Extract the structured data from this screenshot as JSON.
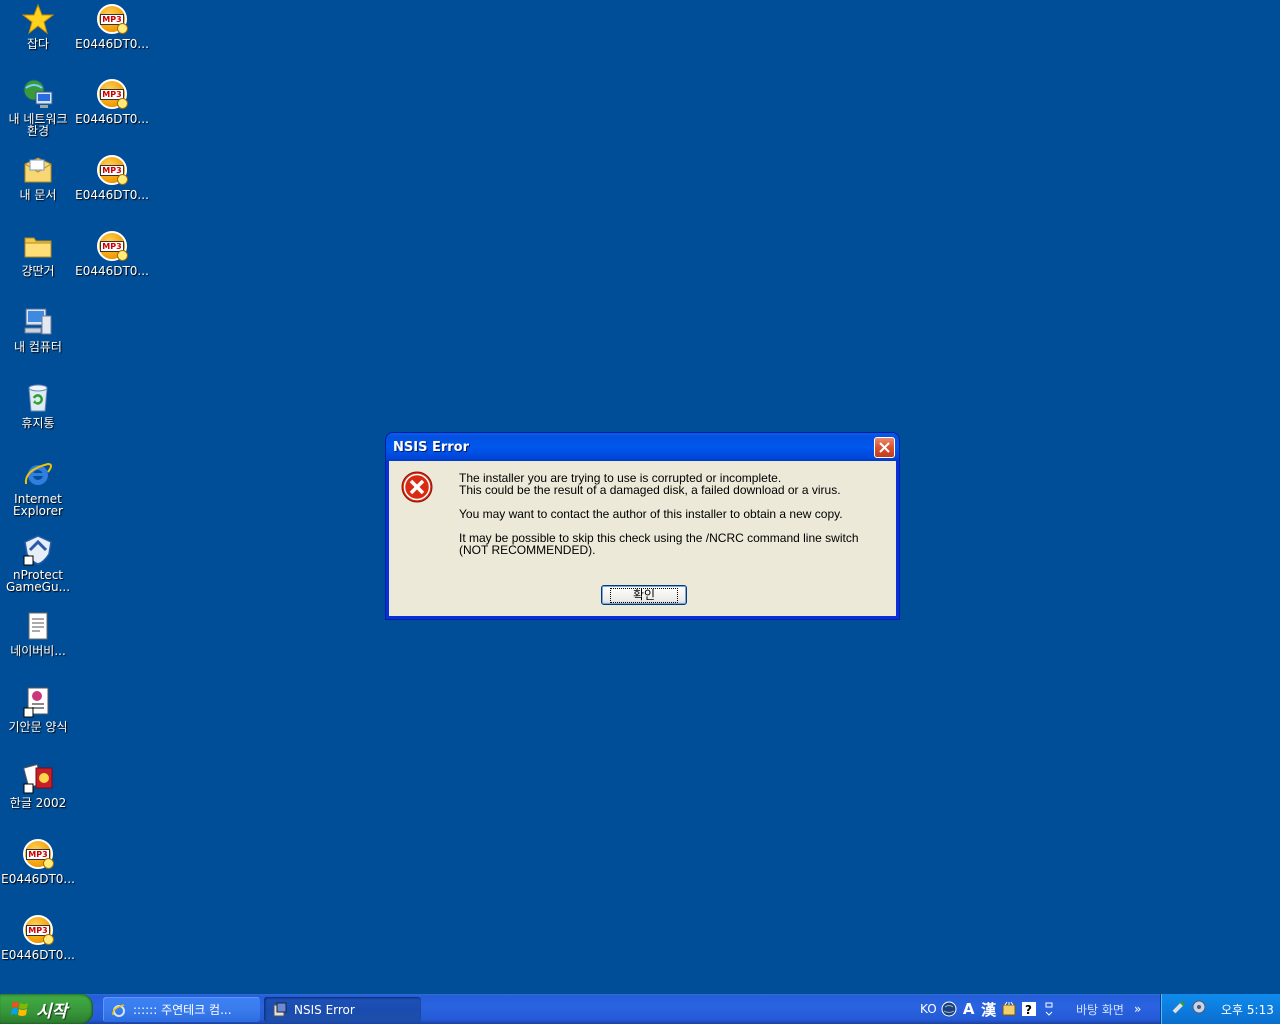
{
  "desktop": {
    "icons": [
      {
        "label": "잡다",
        "icon": "star-icon"
      },
      {
        "label": "내 네트워크 환경",
        "icon": "network-icon"
      },
      {
        "label": "내 문서",
        "icon": "my-documents-icon"
      },
      {
        "label": "걍딴거",
        "icon": "folder-icon"
      },
      {
        "label": "내 컴퓨터",
        "icon": "my-computer-icon"
      },
      {
        "label": "휴지통",
        "icon": "recycle-bin-icon"
      },
      {
        "label": "Internet Explorer",
        "icon": "internet-explorer-icon"
      },
      {
        "label": "nProtect GameGu...",
        "icon": "nprotect-shield-icon"
      },
      {
        "label": "네이버비...",
        "icon": "text-file-icon"
      },
      {
        "label": "기안문 양식",
        "icon": "hwp-document-icon"
      },
      {
        "label": "한글 2002",
        "icon": "hangul-2002-icon"
      },
      {
        "label": "E0446DT0...",
        "icon": "mp3-icon"
      },
      {
        "label": "E0446DT0...",
        "icon": "mp3-icon"
      },
      {
        "label": "E0446DT0...",
        "icon": "mp3-icon"
      },
      {
        "label": "E0446DT0...",
        "icon": "mp3-icon"
      },
      {
        "label": "E0446DT0...",
        "icon": "mp3-icon"
      },
      {
        "label": "E0446DT0...",
        "icon": "mp3-icon"
      }
    ]
  },
  "dialog": {
    "title": "NSIS Error",
    "line1": "The installer you are trying to use is corrupted or incomplete.",
    "line2": "This could be the result of a damaged disk, a failed download or a virus.",
    "line3": "You may want to contact the author of this installer to obtain a new copy.",
    "line4": "It may be possible to skip this check using the /NCRC command line switch",
    "line5": "(NOT RECOMMENDED).",
    "ok_label": "확인"
  },
  "taskbar": {
    "start_label": "시작",
    "tasks": [
      {
        "label": ":::::: 주연테크 컴...",
        "icon": "internet-explorer-icon"
      },
      {
        "label": "NSIS Error",
        "icon": "installer-icon"
      }
    ],
    "language": "KO",
    "ime_labels": [
      "A",
      "漢"
    ],
    "desktop_label": "바탕 화면",
    "chevron": "»",
    "clock": "오후 5:13"
  },
  "colors": {
    "desktop_bg": "#004e98",
    "taskbar_blue": "#245edb",
    "start_green": "#3c9a3c",
    "dialog_bg": "#ece9d8",
    "titlebar_blue": "#0058ee"
  }
}
